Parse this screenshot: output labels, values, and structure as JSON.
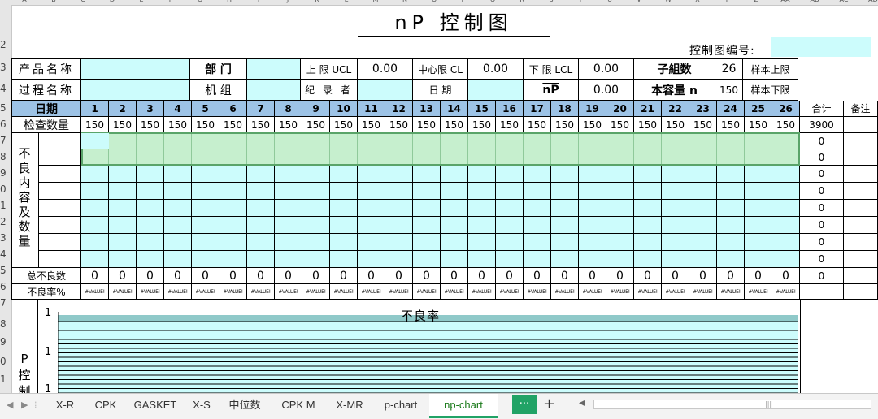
{
  "title": "nP  控制图",
  "control_no_label": "控制图编号:",
  "info_row1": {
    "product_name": "产品名称",
    "department": "部  门",
    "upper_limit_label": "上 限 UCL",
    "upper_limit_value": "0.00",
    "center_limit_label": "中心限 CL",
    "center_limit_value": "0.00",
    "lower_limit_label": "下 限 LCL",
    "lower_limit_value": "0.00",
    "subgroups_label": "子組数",
    "subgroups_value": "26",
    "sample_upper_label": "样本上限"
  },
  "info_row2": {
    "process_name": "过程名称",
    "machine": "机  组",
    "recorder": "纪 录 者",
    "date": "日 期",
    "np_bar_label": "nP",
    "np_bar_value": "0.00",
    "capacity_label": "本容量 n",
    "capacity_value": "150",
    "sample_lower_label": "样本下限"
  },
  "date_label": "日期",
  "days": [
    "1",
    "2",
    "3",
    "4",
    "5",
    "6",
    "7",
    "8",
    "9",
    "10",
    "11",
    "12",
    "13",
    "14",
    "15",
    "16",
    "17",
    "18",
    "19",
    "20",
    "21",
    "22",
    "23",
    "24",
    "25",
    "26"
  ],
  "total_label": "合计",
  "remark_label": "备注",
  "inspect_label": "检查数量",
  "inspect_values": [
    "150",
    "150",
    "150",
    "150",
    "150",
    "150",
    "150",
    "150",
    "150",
    "150",
    "150",
    "150",
    "150",
    "150",
    "150",
    "150",
    "150",
    "150",
    "150",
    "150",
    "150",
    "150",
    "150",
    "150",
    "150",
    "150"
  ],
  "inspect_total": "3900",
  "defect_section_label": "不良内容及数量",
  "defect_row_totals": [
    "0",
    "0",
    "0",
    "0",
    "0",
    "0",
    "0",
    "0"
  ],
  "total_defect_label": "总不良数",
  "total_defect_values": [
    "0",
    "0",
    "0",
    "0",
    "0",
    "0",
    "0",
    "0",
    "0",
    "0",
    "0",
    "0",
    "0",
    "0",
    "0",
    "0",
    "0",
    "0",
    "0",
    "0",
    "0",
    "0",
    "0",
    "0",
    "0",
    "0"
  ],
  "total_defect_sum": "0",
  "defect_rate_label": "不良率%",
  "defect_rate_values": [
    "#VALUE!",
    "#VALUE!",
    "#VALUE!",
    "#VALUE!",
    "#VALUE!",
    "#VALUE!",
    "#VALUE!",
    "#VALUE!",
    "#VALUE!",
    "#VALUE!",
    "#VALUE!",
    "#VALUE!",
    "#VALUE!",
    "#VALUE!",
    "#VALUE!",
    "#VALUE!",
    "#VALUE!",
    "#VALUE!",
    "#VALUE!",
    "#VALUE!",
    "#VALUE!",
    "#VALUE!",
    "#VALUE!",
    "#VALUE!",
    "#VALUE!",
    "#VALUE!"
  ],
  "chart": {
    "title": "不良率",
    "y_ticks": [
      "1",
      "1",
      "1"
    ],
    "side_label": "P控制"
  },
  "sheet_tabs": [
    "X-R",
    "CPK",
    "GASKET",
    "X-S",
    "中位数",
    "CPK M",
    "X-MR",
    "p-chart",
    "np-chart"
  ],
  "active_tab": "np-chart",
  "more_tabs_label": "···",
  "add_tab_label": "+",
  "colors": {
    "cyan_fill": "#ccfcfc",
    "blue_header": "#9dc3e6",
    "green_selection": "#c6efce",
    "tab_active": "#21a366"
  },
  "icons": [
    "prev-sheet-icon",
    "next-sheet-icon",
    "more-sheets-icon",
    "add-sheet-icon"
  ]
}
